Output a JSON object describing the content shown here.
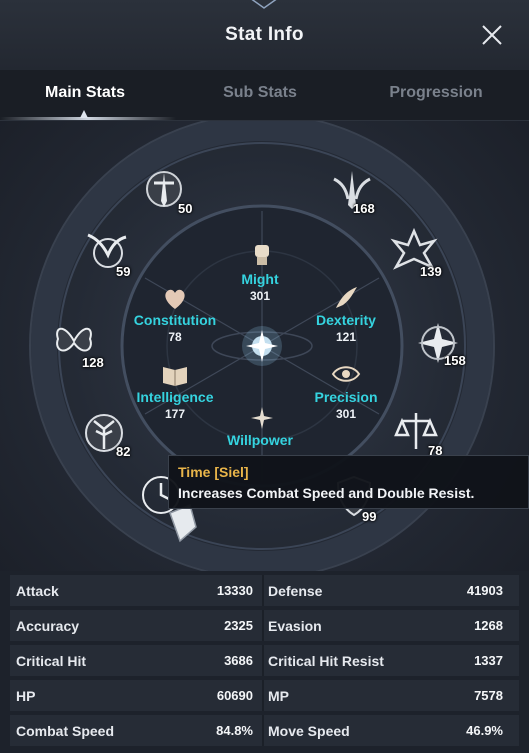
{
  "window": {
    "title": "Stat Info",
    "close_icon": "close-icon"
  },
  "tabs": [
    {
      "label": "Main Stats",
      "active": true
    },
    {
      "label": "Sub Stats",
      "active": false
    },
    {
      "label": "Progression",
      "active": false
    }
  ],
  "main_stats": {
    "might": {
      "label": "Might",
      "value": "301",
      "icon": "fist-icon"
    },
    "constitution": {
      "label": "Constitution",
      "value": "78",
      "icon": "heart-icon"
    },
    "dexterity": {
      "label": "Dexterity",
      "value": "121",
      "icon": "wing-icon"
    },
    "intelligence": {
      "label": "Intelligence",
      "value": "177",
      "icon": "book-icon"
    },
    "precision": {
      "label": "Precision",
      "value": "301",
      "icon": "eye-icon"
    },
    "willpower": {
      "label": "Willpower",
      "value": "",
      "icon": "star-burst-icon"
    }
  },
  "deity_nodes": [
    {
      "value": "50",
      "icon": "sword-emblem-icon"
    },
    {
      "value": "168",
      "icon": "winged-blade-icon"
    },
    {
      "value": "59",
      "icon": "bird-emblem-icon"
    },
    {
      "value": "139",
      "icon": "spiked-crest-icon"
    },
    {
      "value": "128",
      "icon": "butterfly-icon"
    },
    {
      "value": "158",
      "icon": "star-emblem-icon"
    },
    {
      "value": "82",
      "icon": "tree-emblem-icon"
    },
    {
      "value": "78",
      "icon": "scales-icon"
    },
    {
      "value": "",
      "icon": "clock-emblem-icon"
    },
    {
      "value": "99",
      "icon": "shield-emblem-icon"
    },
    {
      "value": "",
      "icon": "crystal-emblem-icon"
    }
  ],
  "tooltip": {
    "title": "Time [Siel]",
    "description": "Increases Combat Speed and Double Resist."
  },
  "stats_table": [
    {
      "left_label": "Attack",
      "left_value": "13330",
      "right_label": "Defense",
      "right_value": "41903"
    },
    {
      "left_label": "Accuracy",
      "left_value": "2325",
      "right_label": "Evasion",
      "right_value": "1268"
    },
    {
      "left_label": "Critical Hit",
      "left_value": "3686",
      "right_label": "Critical Hit Resist",
      "right_value": "1337"
    },
    {
      "left_label": "HP",
      "left_value": "60690",
      "right_label": "MP",
      "right_value": "7578"
    },
    {
      "left_label": "Combat Speed",
      "left_value": "84.8%",
      "right_label": "Move Speed",
      "right_value": "46.9%"
    }
  ],
  "colors": {
    "stat_label": "#35d3df",
    "tooltip_title": "#e9b54a",
    "background": "#1d222b"
  }
}
